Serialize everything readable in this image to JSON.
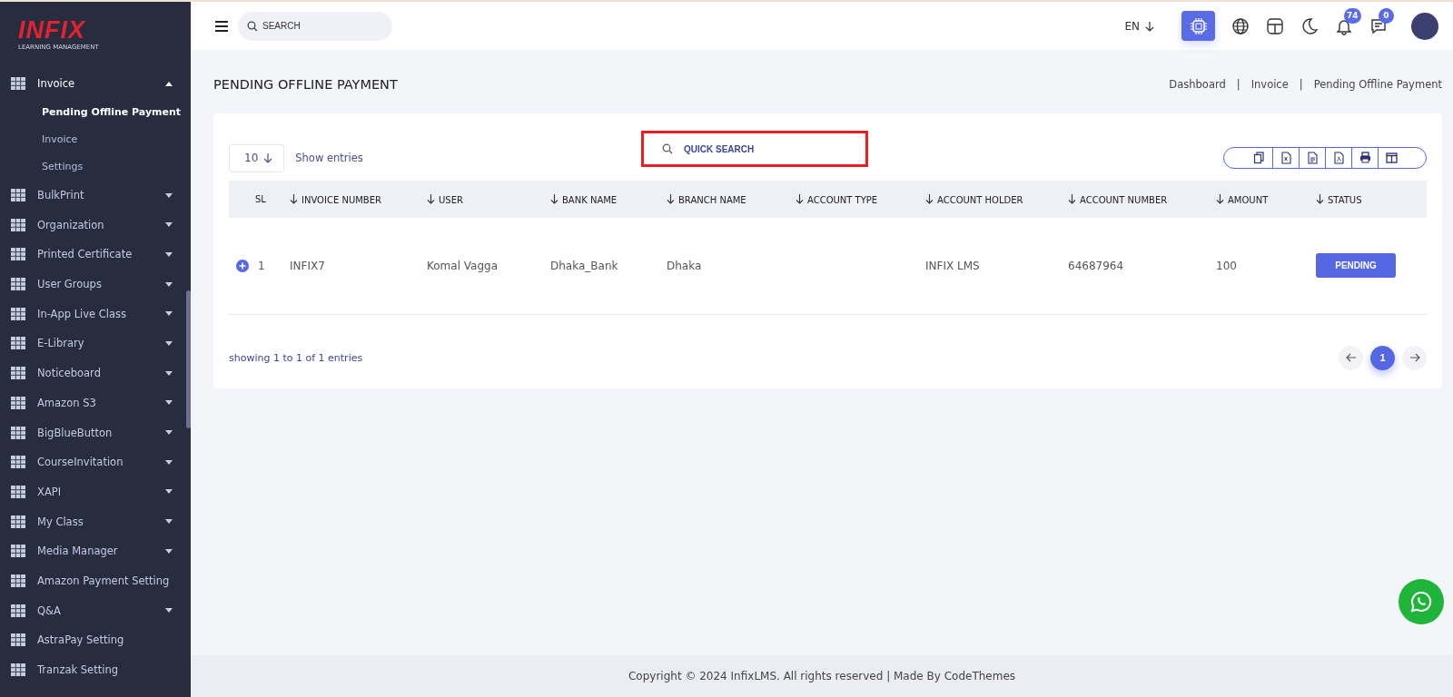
{
  "logo": {
    "word": "INFIX",
    "tagline": "LEARNING MANAGEMENT"
  },
  "sidebar": {
    "items": [
      {
        "label": "Invoice",
        "expandable": true,
        "expanded": true,
        "children": [
          {
            "label": "Pending Offline Payment",
            "selected": true
          },
          {
            "label": "Invoice",
            "selected": false
          },
          {
            "label": "Settings",
            "selected": false
          }
        ]
      },
      {
        "label": "BulkPrint",
        "expandable": true,
        "expanded": false
      },
      {
        "label": "Organization",
        "expandable": true,
        "expanded": false
      },
      {
        "label": "Printed Certificate",
        "expandable": true,
        "expanded": false
      },
      {
        "label": "User Groups",
        "expandable": true,
        "expanded": false
      },
      {
        "label": "In-App Live Class",
        "expandable": true,
        "expanded": false
      },
      {
        "label": "E-Library",
        "expandable": true,
        "expanded": false
      },
      {
        "label": "Noticeboard",
        "expandable": true,
        "expanded": false
      },
      {
        "label": "Amazon S3",
        "expandable": true,
        "expanded": false
      },
      {
        "label": "BigBlueButton",
        "expandable": true,
        "expanded": false
      },
      {
        "label": "CourseInvitation",
        "expandable": true,
        "expanded": false
      },
      {
        "label": "XAPI",
        "expandable": true,
        "expanded": false
      },
      {
        "label": "My Class",
        "expandable": true,
        "expanded": false
      },
      {
        "label": "Media Manager",
        "expandable": true,
        "expanded": false
      },
      {
        "label": "Amazon Payment Setting",
        "expandable": false,
        "expanded": false
      },
      {
        "label": "Q&A",
        "expandable": true,
        "expanded": false
      },
      {
        "label": "AstraPay Setting",
        "expandable": false,
        "expanded": false
      },
      {
        "label": "Tranzak Setting",
        "expandable": false,
        "expanded": false
      }
    ]
  },
  "topbar": {
    "search": {
      "placeholder": "SEARCH"
    },
    "language": "EN",
    "notifications": "74",
    "messages": "0"
  },
  "page": {
    "title": "PENDING OFFLINE PAYMENT",
    "breadcrumbs": [
      "Dashboard",
      "Invoice",
      "Pending Offline Payment"
    ],
    "breadcrumb_separators": [
      "|",
      "|"
    ]
  },
  "table_controls": {
    "page_size": "10",
    "page_size_label": "Show entries",
    "quick_search": {
      "placeholder": "QUICK SEARCH",
      "highlighted": true
    },
    "export_buttons": [
      {
        "kind": "copy"
      },
      {
        "kind": "excel"
      },
      {
        "kind": "csv"
      },
      {
        "kind": "pdf"
      },
      {
        "kind": "print"
      },
      {
        "kind": "columns"
      }
    ]
  },
  "table": {
    "columns": [
      "SL",
      "INVOICE NUMBER",
      "USER",
      "BANK NAME",
      "BRANCH NAME",
      "ACCOUNT TYPE",
      "ACCOUNT HOLDER",
      "ACCOUNT NUMBER",
      "AMOUNT",
      "STATUS"
    ],
    "rows": [
      {
        "sl": "1",
        "invoice_number": "INFIX7",
        "user": "Komal Vagga",
        "bank_name": "Dhaka_Bank",
        "branch_name": "Dhaka",
        "account_holder": "INFIX LMS",
        "account_number": "64687964",
        "amount": "100",
        "status": "PENDING"
      }
    ]
  },
  "footer_info": "showing 1 to 1 of 1 entries",
  "pagination": {
    "pages": [
      {
        "label": "1",
        "selected": true
      }
    ]
  },
  "copyright": "Copyright © 2024 InfixLMS. All rights reserved | Made By CodeThemes"
}
